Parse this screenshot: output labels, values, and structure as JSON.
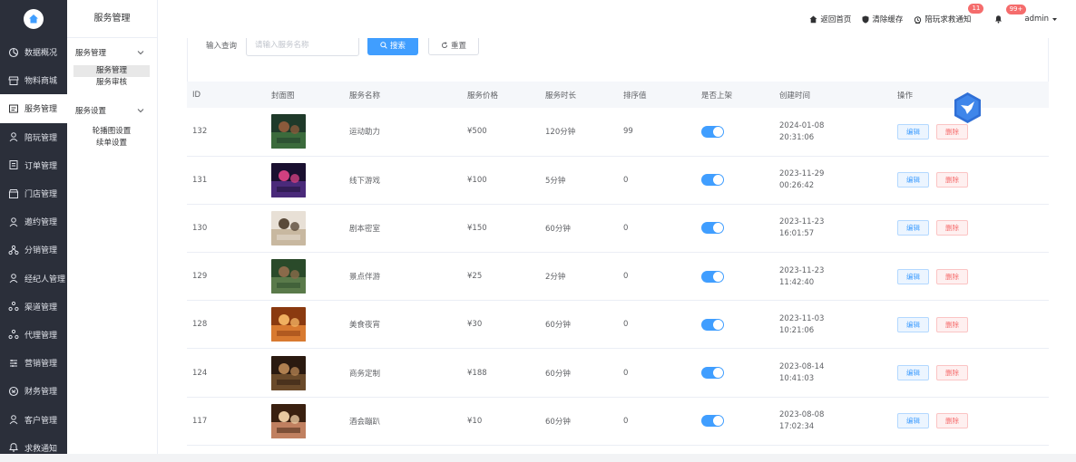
{
  "sidebar": {
    "items": [
      {
        "label": "数据概况",
        "icon": "chart-pie-icon"
      },
      {
        "label": "物料商城",
        "icon": "shop-icon"
      },
      {
        "label": "服务管理",
        "icon": "service-icon",
        "active": true
      },
      {
        "label": "陪玩管理",
        "icon": "companion-icon"
      },
      {
        "label": "订单管理",
        "icon": "order-icon"
      },
      {
        "label": "门店管理",
        "icon": "store-icon"
      },
      {
        "label": "邀约管理",
        "icon": "invite-icon"
      },
      {
        "label": "分销管理",
        "icon": "distribution-icon"
      },
      {
        "label": "经纪人管理",
        "icon": "agent-icon"
      },
      {
        "label": "渠道管理",
        "icon": "channel-icon"
      },
      {
        "label": "代理管理",
        "icon": "proxy-icon"
      },
      {
        "label": "营销管理",
        "icon": "marketing-icon"
      },
      {
        "label": "财务管理",
        "icon": "finance-icon"
      },
      {
        "label": "客户管理",
        "icon": "customer-icon"
      },
      {
        "label": "求救通知",
        "icon": "bell-icon"
      }
    ]
  },
  "submenu": {
    "title": "服务管理",
    "group1": {
      "label": "服务管理",
      "children": [
        "服务管理",
        "服务审核"
      ]
    },
    "group2": {
      "label": "服务设置",
      "children": [
        "轮播图设置",
        "续单设置"
      ]
    }
  },
  "topbar": {
    "home": "返回首页",
    "clear_cache": "清除缓存",
    "sos_notice": "陪玩求救通知",
    "sos_badge": "11",
    "bell_badge": "99+",
    "user": "admin"
  },
  "search": {
    "label": "输入查询",
    "placeholder": "请输入服务名称",
    "value": "",
    "search_button": "搜索",
    "reset_button": "重置"
  },
  "table": {
    "headers": [
      "ID",
      "封面图",
      "服务名称",
      "服务价格",
      "服务时长",
      "排序值",
      "是否上架",
      "创建时间",
      "操作"
    ],
    "edit_label": "编辑",
    "delete_label": "删除",
    "rows": [
      {
        "id": "132",
        "name": "运动助力",
        "price": "¥500",
        "duration": "120分钟",
        "sort": "99",
        "on_shelf": true,
        "date": "2024-01-08",
        "time": "20:31:06",
        "thumb_colors": [
          "#1f3a2a",
          "#3b6b3c",
          "#8a5a3b"
        ]
      },
      {
        "id": "131",
        "name": "线下游戏",
        "price": "¥100",
        "duration": "5分钟",
        "sort": "0",
        "on_shelf": true,
        "date": "2023-11-29",
        "time": "00:26:42",
        "thumb_colors": [
          "#1a1030",
          "#4a2a7a",
          "#d04080"
        ]
      },
      {
        "id": "130",
        "name": "剧本密室",
        "price": "¥150",
        "duration": "60分钟",
        "sort": "0",
        "on_shelf": true,
        "date": "2023-11-23",
        "time": "16:01:57",
        "thumb_colors": [
          "#e8e0d6",
          "#c8b8a0",
          "#5a4a3a"
        ]
      },
      {
        "id": "129",
        "name": "景点伴游",
        "price": "¥25",
        "duration": "2分钟",
        "sort": "0",
        "on_shelf": true,
        "date": "2023-11-23",
        "time": "11:42:40",
        "thumb_colors": [
          "#2a4a2a",
          "#5a7a4a",
          "#8a6a4a"
        ]
      },
      {
        "id": "128",
        "name": "美食夜宵",
        "price": "¥30",
        "duration": "60分钟",
        "sort": "0",
        "on_shelf": true,
        "date": "2023-11-03",
        "time": "10:21:06",
        "thumb_colors": [
          "#8a3a10",
          "#d87a30",
          "#f0b060"
        ]
      },
      {
        "id": "124",
        "name": "商务定制",
        "price": "¥188",
        "duration": "60分钟",
        "sort": "0",
        "on_shelf": true,
        "date": "2023-08-14",
        "time": "10:41:03",
        "thumb_colors": [
          "#2a1a10",
          "#6a4a2a",
          "#b08050"
        ]
      },
      {
        "id": "117",
        "name": "酒会蹦趴",
        "price": "¥10",
        "duration": "60分钟",
        "sort": "0",
        "on_shelf": true,
        "date": "2023-08-08",
        "time": "17:02:34",
        "thumb_colors": [
          "#3a2010",
          "#c08060",
          "#e8c8a0"
        ]
      }
    ]
  },
  "colors": {
    "sidebar_bg": "#2b2f3a",
    "primary": "#409eff",
    "danger": "#f56c6c",
    "badge": "#f56c6c"
  }
}
